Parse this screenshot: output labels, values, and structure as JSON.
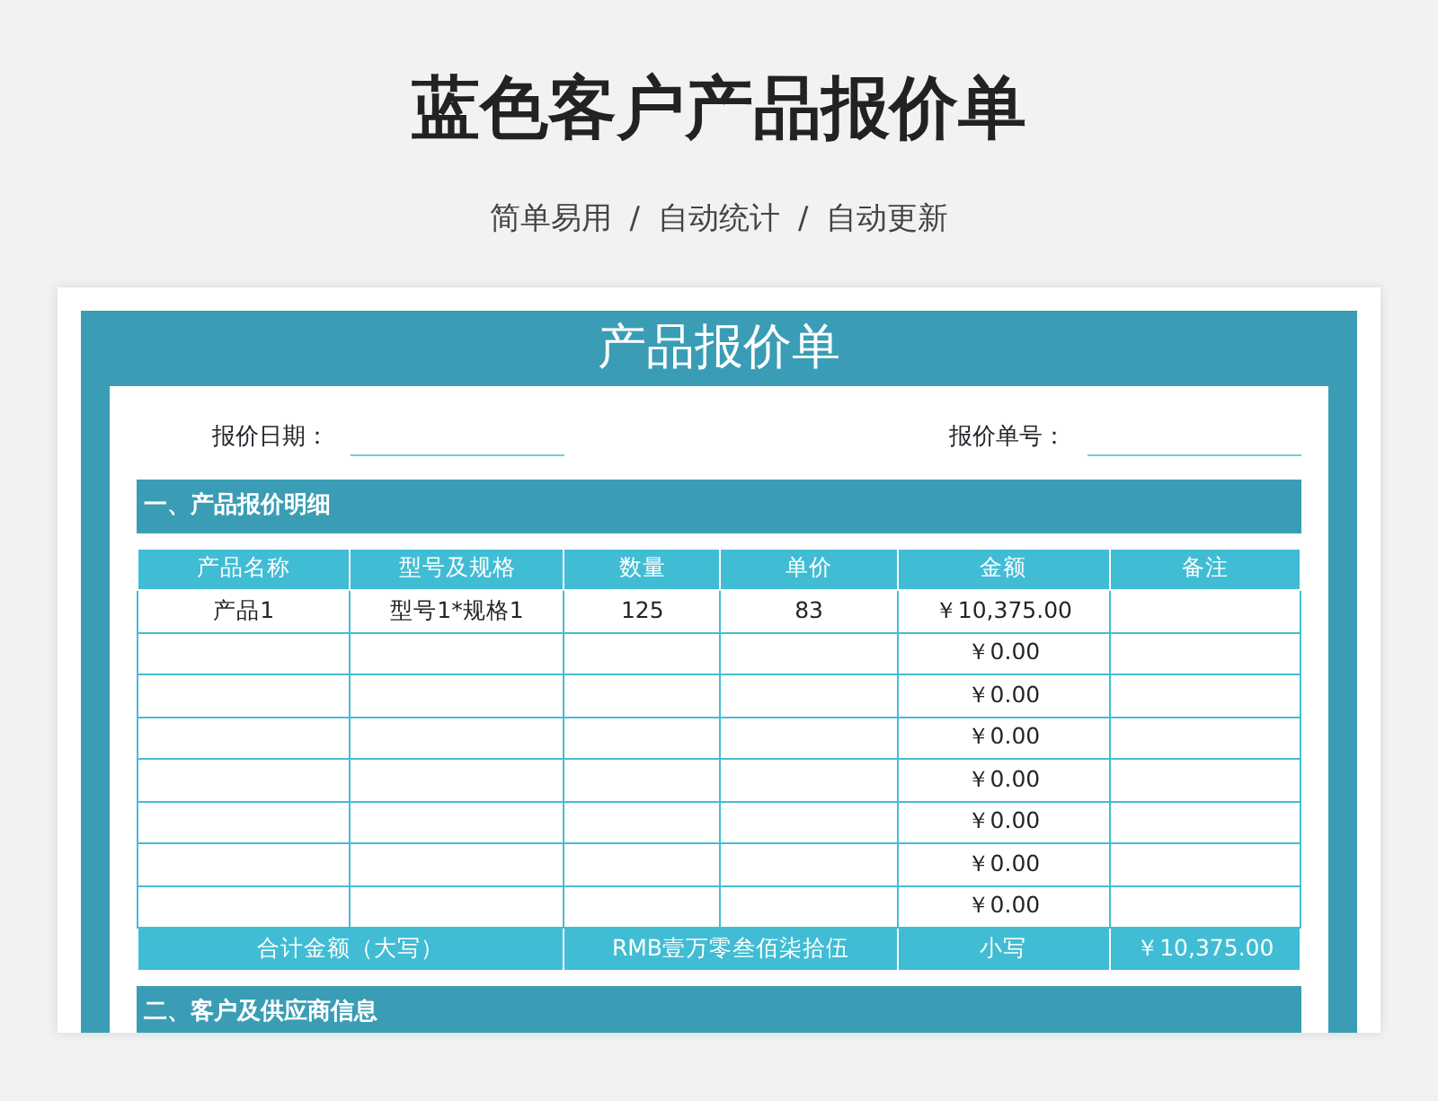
{
  "page_title": "蓝色客户产品报价单",
  "tagline": [
    "简单易用",
    "/",
    "自动统计",
    "/",
    "自动更新"
  ],
  "sheet": {
    "title": "产品报价单",
    "fields": [
      {
        "label": "报价日期："
      },
      {
        "label": "报价单号："
      }
    ],
    "section_1": "一、产品报价明细",
    "table": {
      "columns": [
        "产品名称",
        "型号及规格",
        "数量",
        "单价",
        "金额",
        "备注"
      ],
      "rows": [
        [
          "产品1",
          "型号1*规格1",
          "125",
          "83",
          "￥10,375.00",
          ""
        ],
        [
          "",
          "",
          "",
          "",
          "￥0.00",
          ""
        ],
        [
          "",
          "",
          "",
          "",
          "￥0.00",
          ""
        ],
        [
          "",
          "",
          "",
          "",
          "￥0.00",
          ""
        ],
        [
          "",
          "",
          "",
          "",
          "￥0.00",
          ""
        ],
        [
          "",
          "",
          "",
          "",
          "￥0.00",
          ""
        ],
        [
          "",
          "",
          "",
          "",
          "￥0.00",
          ""
        ],
        [
          "",
          "",
          "",
          "",
          "￥0.00",
          ""
        ]
      ],
      "total": {
        "label": "合计金额（大写）",
        "words": "RMB壹万零叁佰柒拾伍",
        "small_label": "小写",
        "amount": "￥10,375.00"
      }
    },
    "section_2": "二、客户及供应商信息"
  }
}
